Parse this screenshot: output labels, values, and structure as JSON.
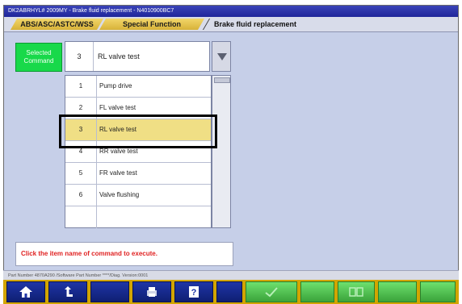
{
  "window": {
    "title": "DK2ABRHYL# 2009MY  -  Brake fluid replacement  -  N4010900BC7"
  },
  "tabs": [
    {
      "label": "ABS/ASC/ASTC/WSS"
    },
    {
      "label": "Special Function"
    },
    {
      "label": "Brake fluid replacement"
    }
  ],
  "selected": {
    "label": "Selected Command",
    "number": "3",
    "name": "RL valve test"
  },
  "commands": [
    {
      "number": "1",
      "name": "Pump drive"
    },
    {
      "number": "2",
      "name": "FL valve test"
    },
    {
      "number": "3",
      "name": "RL valve test"
    },
    {
      "number": "4",
      "name": "RR valve test"
    },
    {
      "number": "5",
      "name": "FR valve test"
    },
    {
      "number": "6",
      "name": "Valve flushing"
    },
    {
      "number": "",
      "name": ""
    }
  ],
  "message": "Click the item name of command to execute.",
  "status": "Part Number 4870A290  /Software Part Number ****/Diag. Version:0001",
  "toolbar": [
    {
      "icon": "home-icon"
    },
    {
      "icon": "back-icon"
    },
    {
      "icon": "blank-icon"
    },
    {
      "icon": "print-icon"
    },
    {
      "icon": "help-icon"
    },
    {
      "icon": "blank-icon"
    },
    {
      "icon": "check-icon"
    },
    {
      "icon": "blank-icon"
    },
    {
      "icon": "compare-icon"
    },
    {
      "icon": "blank-icon"
    },
    {
      "icon": "blank-icon"
    }
  ],
  "colors": {
    "selected_green": "#18d94a",
    "highlight_row": "#f0df85",
    "message_red": "#e02222",
    "toolbar_blue": "#1f35a6",
    "toolbar_gold": "#d2a500"
  }
}
